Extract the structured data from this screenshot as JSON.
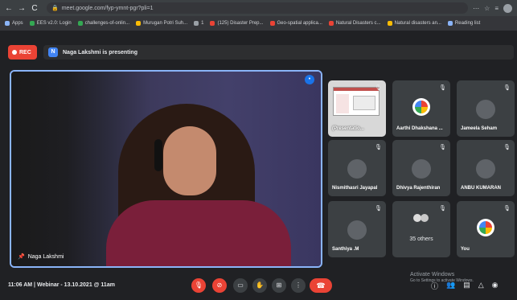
{
  "browser": {
    "back": "←",
    "forward": "→",
    "reload": "C",
    "url": "meet.google.com/fyp-ymnt-pgr?pli=1",
    "right_icons": [
      "⋯",
      "☆",
      "≡"
    ],
    "bookmarks": [
      {
        "label": "Apps",
        "color": "#8ab4f8"
      },
      {
        "label": "EES v2.0: Login",
        "color": "#34a853"
      },
      {
        "label": "challenges-of-onlin...",
        "color": "#34a853"
      },
      {
        "label": "Murugan Potri Suh...",
        "color": "#fbbc05"
      },
      {
        "label": "1",
        "color": "#9aa0a6"
      },
      {
        "label": "(125) Disaster Prep...",
        "color": "#ea4335"
      },
      {
        "label": "Geo-spatial applica...",
        "color": "#ea4335"
      },
      {
        "label": "Natural Disasters c...",
        "color": "#ea4335"
      },
      {
        "label": "Natural disasters an...",
        "color": "#fbbc05"
      },
      {
        "label": "Reading list",
        "color": "#8ab4f8"
      }
    ]
  },
  "meet": {
    "rec_label": "REC",
    "presenter_initial": "N",
    "presenting_text": "Naga Lakshmi is presenting",
    "main_speaker": "Naga Lakshmi",
    "participants": [
      {
        "name": "(Presentatio...",
        "kind": "screen"
      },
      {
        "name": "Aarthi Dhakshana ...",
        "kind": "pfp"
      },
      {
        "name": "Jameela Seham",
        "kind": "avatar"
      },
      {
        "name": "Nismithasri Jayapal",
        "kind": "avatar"
      },
      {
        "name": "Dhivya Rajenthiran",
        "kind": "avatar"
      },
      {
        "name": "ANBU KUMARAN",
        "kind": "avatar"
      },
      {
        "name": "Santhiya .M",
        "kind": "avatar"
      },
      {
        "name": "35 others",
        "kind": "others"
      },
      {
        "name": "You",
        "kind": "pfp"
      }
    ],
    "time": "11:06 AM",
    "separator": "|",
    "meeting_title": "Webinar - 13.10.2021 @ 11am",
    "watermark_title": "Activate Windows",
    "watermark_sub": "Go to Settings to activate Windows."
  }
}
